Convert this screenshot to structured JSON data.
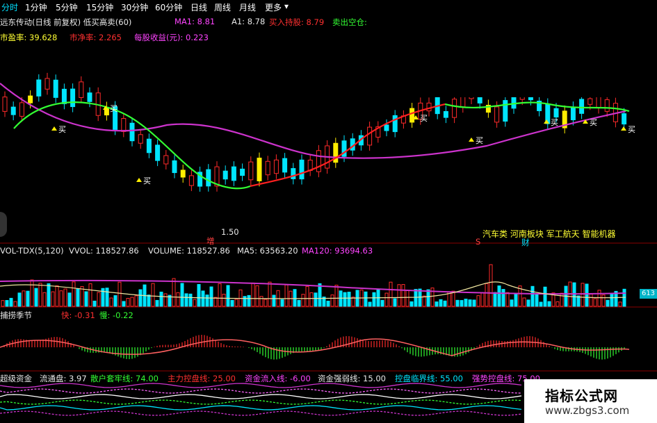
{
  "toolbar": {
    "tabs": [
      {
        "label": "分时",
        "active": true
      },
      {
        "label": "1分钟"
      },
      {
        "label": "5分钟"
      },
      {
        "label": "15分钟"
      },
      {
        "label": "30分钟"
      },
      {
        "label": "60分钟"
      },
      {
        "label": "日线"
      },
      {
        "label": "周线"
      },
      {
        "label": "月线"
      },
      {
        "label": "更多"
      }
    ],
    "more_arrow": "▾"
  },
  "main_panel": {
    "stock_title": "远东传动(日线 前复权) 低买高卖(60)",
    "ma1": "MA1: 8.81",
    "a1": "A1: 8.78",
    "buy_hold": "买入持股: 8.79",
    "sell_short": "卖出空仓:",
    "pe": "市盈率: 39.628",
    "pb": "市净率: 2.265",
    "eps": "每股收益(元): 0.223",
    "buy_marker": "买",
    "low_price": "1.50",
    "increase_label": "增",
    "s_label": "S",
    "concept_tags": "汽车类 河南板块 军工航天 智能机器",
    "finance_label": "财"
  },
  "volume_panel": {
    "indicator": "VOL-TDX(5,120)",
    "vvol": "VVOL: 118527.86",
    "volume": "VOLUME: 118527.86",
    "ma5": "MA5: 63563.20",
    "ma120": "MA120: 93694.63",
    "price_tag": "613"
  },
  "season_panel": {
    "name": "捕捞季节",
    "fast": "快: -0.31",
    "slow": "慢: -0.22"
  },
  "fund_panel": {
    "name": "超级资金",
    "float": "流通盘: 3.97",
    "retail": "散户套牢线: 74.00",
    "main_control": "主力控盘线: 25.00",
    "inflow": "资金流入线: -6.00",
    "strength": "资金强弱线: 15.00",
    "control_critical": "控盘临界线: 55.00",
    "strong_control": "强势控盘线: 75.00"
  },
  "watermark": {
    "title": "指标公式网",
    "url": "www.zbgs3.com"
  },
  "colors": {
    "up": "#ff2a2a",
    "down": "#00e5ff",
    "yellow": "#ffee00",
    "ma_green": "#33ff33",
    "ma_red": "#ff2020",
    "ma_magenta": "#cc33cc",
    "background": "#000000"
  }
}
